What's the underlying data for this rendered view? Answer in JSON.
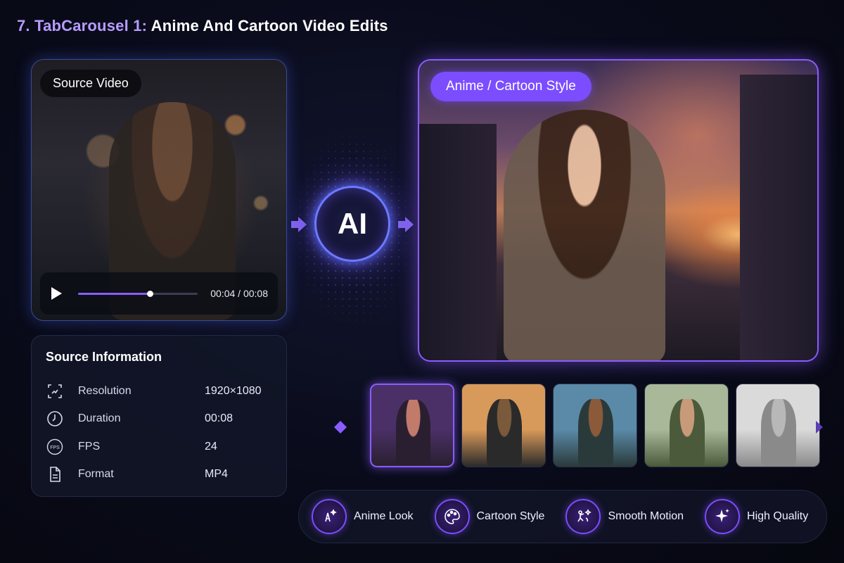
{
  "header": {
    "number_prefix": "7. TabCarousel 1:",
    "title": "Anime And Cartoon Video Edits"
  },
  "source_video": {
    "badge": "Source Video",
    "time": "00:04 / 00:08",
    "progress": 0.6
  },
  "source_info": {
    "title": "Source Information",
    "rows": [
      {
        "icon": "resolution-icon",
        "label": "Resolution",
        "value": "1920×1080"
      },
      {
        "icon": "clock-icon",
        "label": "Duration",
        "value": "00:08"
      },
      {
        "icon": "fps-icon",
        "label": "FPS",
        "value": "24"
      },
      {
        "icon": "file-icon",
        "label": "Format",
        "value": "MP4"
      }
    ]
  },
  "ai": {
    "label": "AI"
  },
  "result": {
    "badge": "Anime / Cartoon Style"
  },
  "thumbnails": [
    {
      "name": "anime-style",
      "active": true,
      "colors": [
        "#4a3066",
        "#c27a6a",
        "#2a1f30"
      ]
    },
    {
      "name": "cartoon-boy-sunset",
      "active": false,
      "colors": [
        "#d89a5a",
        "#7a5a3a",
        "#2a2a2a"
      ]
    },
    {
      "name": "cartoon-boy-3d",
      "active": false,
      "colors": [
        "#5a8aa8",
        "#8a5a3a",
        "#2a3a3a"
      ]
    },
    {
      "name": "clay-style",
      "active": false,
      "colors": [
        "#a8b898",
        "#c89a7a",
        "#4a5a3a"
      ]
    },
    {
      "name": "sketch-style",
      "active": false,
      "colors": [
        "#dadada",
        "#b8b8b8",
        "#8a8a8a"
      ]
    }
  ],
  "features": [
    {
      "icon": "anime-look-icon",
      "label": "Anime Look"
    },
    {
      "icon": "palette-icon",
      "label": "Cartoon Style"
    },
    {
      "icon": "motion-icon",
      "label": "Smooth Motion"
    },
    {
      "icon": "sparkle-icon",
      "label": "High Quality"
    }
  ],
  "colors": {
    "accent": "#8a5cff",
    "background": "#090b1a",
    "title_accent": "#b79cff"
  }
}
